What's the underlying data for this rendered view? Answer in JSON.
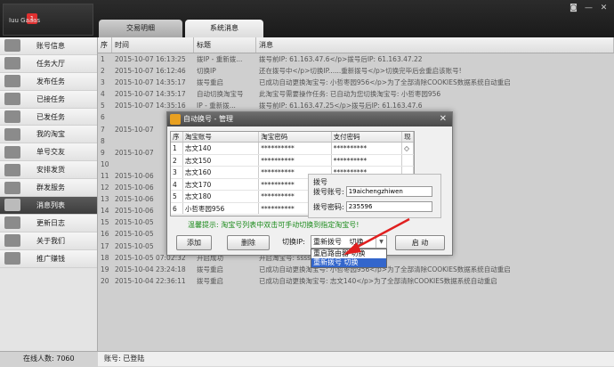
{
  "header": {
    "logo_text": "Iuu Gaaas",
    "badge": "1",
    "tabs": [
      "交易明细",
      "系统消息"
    ],
    "window_buttons": [
      "◙",
      "—",
      "✕"
    ]
  },
  "sidebar": {
    "items": [
      "账号信息",
      "任务大厅",
      "发布任务",
      "已接任务",
      "已发任务",
      "我的淘宝",
      "单号交友",
      "安排发货",
      "群发服务",
      "消息列表",
      "更新日志",
      "关于我们",
      "推广赚钱"
    ],
    "active_index": 9,
    "icons": [
      "user-icon",
      "user-icon",
      "calendar-icon",
      "calendar-icon",
      "calendar-icon",
      "taobao-icon",
      "id-card-icon",
      "truck-icon",
      "mail-icon",
      "chat-icon",
      "list-icon",
      "user-card-icon",
      "user-card-icon"
    ]
  },
  "table": {
    "headers": [
      "序",
      "时间",
      "标题",
      "消息"
    ],
    "rows": [
      [
        "1",
        "2015-10-07 16:13:25",
        "拨IP - 重新拨...",
        "拨号前IP: 61.163.47.6</p>拨号后IP: 61.163.47.22"
      ],
      [
        "2",
        "2015-10-07 16:12:46",
        "切换IP",
        "还在拨号中</p>切换IP......重新拨号</p>切换完毕后会重启该账号!"
      ],
      [
        "3",
        "2015-10-07 14:35:17",
        "拨号重启",
        "已成功自动更换淘宝号: 小哲枣园956</p>为了全部清除COOKIES数据系统自动重启"
      ],
      [
        "4",
        "2015-10-07 14:35:17",
        "自动切换淘宝号",
        "此淘宝号需要操作任务: 已自动为您切换淘宝号: 小哲枣园956"
      ],
      [
        "5",
        "2015-10-07 14:35:16",
        "IP - 重新拨...",
        "拨号前IP: 61.163.47.25</p>拨号后IP: 61.163.47.6"
      ],
      [
        "6",
        "",
        "",
        "已成功自动更换淘宝号"
      ],
      [
        "7",
        "2015-10-07",
        "",
        "</p>自动更换淘宝号 - 已启用</p> 自动..."
      ],
      [
        "8",
        "",
        "",
        ""
      ],
      [
        "9",
        "2015-10-07",
        "",
        "拨号前IP: 61.163.47.19"
      ],
      [
        "10",
        "",
        "",
        ""
      ],
      [
        "11",
        "2015-10-06",
        "",
        "宝商标记: 旗帜为: 红色旗帜</p>天猫!"
      ],
      [
        "12",
        "2015-10-06",
        "",
        "www.taobao.com/item.htm?id=37040758"
      ],
      [
        "13",
        "2015-10-06",
        "",
        "ttps://item.taobao.com/item.htm?i"
      ],
      [
        "14",
        "2015-10-06",
        "",
        "www.taobao.com/item.htm?id=3704075848"
      ],
      [
        "15",
        "2015-10-05",
        "",
        "abao.com/item.htm?id=370407584837"
      ],
      [
        "16",
        "2015-10-05",
        "",
        "tem.taobao.com/search?q=%E5%AE%A4%E5%"
      ],
      [
        "17",
        "2015-10-05",
        "",
        "此账户您不在电脑前时可点击《开发任务"
      ],
      [
        "18",
        "2015-10-05 07:02:32",
        "开启成功",
        "开启淘宝号: ssss11111155647231"
      ],
      [
        "19",
        "2015-10-04 23:24:18",
        "拨号重启",
        "已成功自动更换淘宝号: 小哲枣园956</p>为了全部清除COOKIES数据系统自动重启"
      ],
      [
        "20",
        "2015-10-04 22:36:11",
        "拨号重启",
        "已成功自动更换淘宝号: 志文140</p>为了全部清除COOKIES数据系统自动重启"
      ]
    ]
  },
  "dialog": {
    "title": "自动换号 - 管理",
    "close": "✕",
    "grid_headers": [
      "序",
      "淘宝账号",
      "淘宝密码",
      "支付密码",
      "现"
    ],
    "grid_rows": [
      [
        "1",
        "志文140",
        "**********",
        "**********",
        "◇"
      ],
      [
        "2",
        "志文150",
        "**********",
        "**********",
        ""
      ],
      [
        "3",
        "志文160",
        "**********",
        "**********",
        ""
      ],
      [
        "4",
        "志文170",
        "**********",
        "**********",
        ""
      ],
      [
        "5",
        "志文180",
        "**********",
        "**********",
        ""
      ],
      [
        "6",
        "小哲枣园956",
        "**********",
        "",
        ""
      ]
    ],
    "pw_panel": {
      "title": "拨号",
      "account_label": "拨号账号:",
      "account_value": "19aichengzhiwen",
      "password_label": "拨号密码:",
      "password_value": "235596"
    },
    "hint": "温馨提示: 淘宝号列表中双击可手动切换到指定淘宝号!",
    "buttons": {
      "add": "添加",
      "delete": "删除",
      "start": "启 动"
    },
    "switch_label": "切换IP:",
    "switch_value": "重新拨号",
    "switch_suffix": "切换",
    "dropdown_options": [
      "重启路由器 切换",
      "重新拨号 切换"
    ],
    "dropdown_selected": 1
  },
  "footer": {
    "online": "在线人数: 7060",
    "account": "账号: 已登陆"
  },
  "colors": {
    "sidebar_active": "#4a4a4a",
    "dropdown_highlight": "#3366cc",
    "hint": "#1a8a1a",
    "arrow": "#e02020"
  }
}
